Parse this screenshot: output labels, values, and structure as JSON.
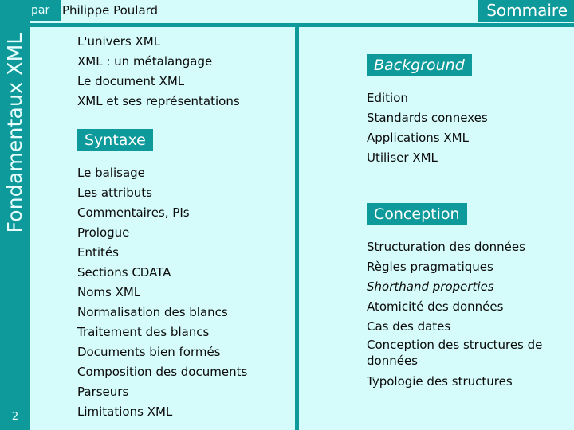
{
  "header": {
    "byline_label": "par",
    "author": "Philippe Poulard",
    "toc_label": "Sommaire"
  },
  "sidebar": {
    "title": "Fondamentaux XML",
    "page_number": "2"
  },
  "colors": {
    "teal": "#0E9A9A",
    "background": "#D5FBFB",
    "text": "#0B0B0B",
    "on_teal": "#FFFFFF"
  },
  "left_column": {
    "intro_items": [
      "L'univers XML",
      "XML : un métalangage",
      "Le document XML",
      "XML et ses représentations"
    ],
    "section": {
      "heading": "Syntaxe",
      "items": [
        "Le balisage",
        "Les attributs",
        "Commentaires, PIs",
        "Prologue",
        "Entités",
        "Sections CDATA",
        "Noms XML",
        "Normalisation des blancs",
        "Traitement des blancs",
        "Documents bien formés",
        "Composition des documents",
        "Parseurs",
        "Limitations XML"
      ]
    }
  },
  "right_column": {
    "sections": [
      {
        "heading": "Background",
        "heading_italic": true,
        "items": [
          {
            "label": "Edition",
            "italic": false
          },
          {
            "label": "Standards connexes",
            "italic": false
          },
          {
            "label": "Applications XML",
            "italic": false
          },
          {
            "label": "Utiliser XML",
            "italic": false
          }
        ]
      },
      {
        "heading": "Conception",
        "heading_italic": false,
        "items": [
          {
            "label": "Structuration des données",
            "italic": false
          },
          {
            "label": "Règles pragmatiques",
            "italic": false
          },
          {
            "label": "Shorthand properties",
            "italic": true
          },
          {
            "label": "Atomicité des données",
            "italic": false
          },
          {
            "label": "Cas des dates",
            "italic": false
          },
          {
            "label": "Conception des structures de données",
            "italic": false,
            "wrap": true
          },
          {
            "label": "Typologie des structures",
            "italic": false
          }
        ]
      }
    ]
  }
}
